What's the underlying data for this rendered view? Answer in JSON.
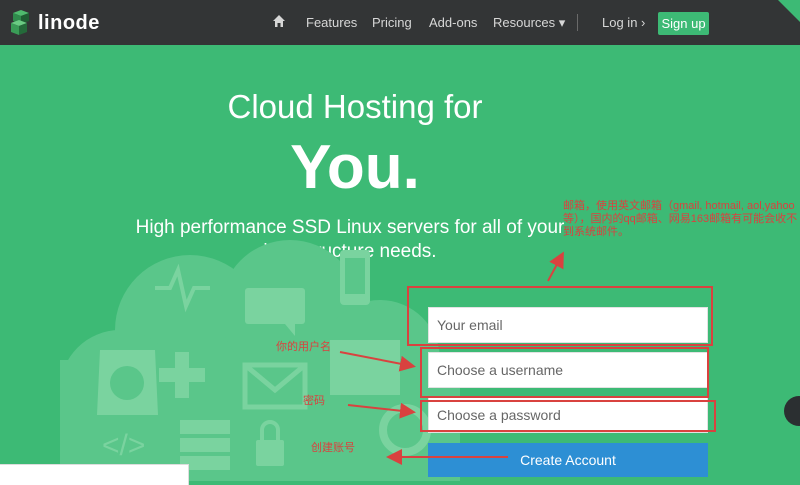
{
  "nav": {
    "logo_text": "linode",
    "links": [
      "Features",
      "Pricing",
      "Add-ons",
      "Resources ▾"
    ],
    "login": "Log in ›",
    "signup": "Sign up"
  },
  "hero": {
    "title_line1": "Cloud Hosting for",
    "title_line2": "You.",
    "subtitle": "High performance SSD Linux servers for all of your infrastructure needs."
  },
  "form": {
    "email_placeholder": "Your email",
    "username_placeholder": "Choose a username",
    "password_placeholder": "Choose a password",
    "submit_label": "Create Account"
  },
  "annotations": {
    "email_note": "邮箱，使用英文邮箱（gmail, hotmail, aol,yahoo等），国内的qq邮箱、网易163邮箱有可能会收不到系统邮件。",
    "username_note": "你的用户名",
    "password_note": "密码",
    "account_note": "创建账号"
  },
  "colors": {
    "nav_bg": "#333536",
    "hero_bg": "#3dba75",
    "button_blue": "#2d8fd4",
    "annotation_red": "#d9423f"
  }
}
